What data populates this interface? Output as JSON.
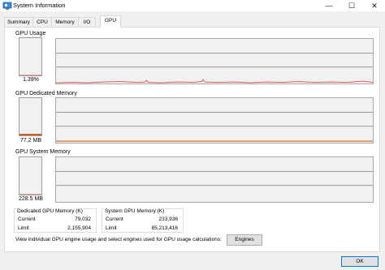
{
  "window": {
    "title": "System Information",
    "app_icon": "system-information-icon",
    "controls": {
      "minimize": "—",
      "maximize": "☐",
      "close": "✕"
    }
  },
  "tabs": [
    {
      "label": "Summary",
      "active": false
    },
    {
      "label": "CPU",
      "active": false
    },
    {
      "label": "Memory",
      "active": false
    },
    {
      "label": "I/O",
      "active": false
    },
    {
      "label": "GPU",
      "active": true
    }
  ],
  "sections": {
    "usage": {
      "label": "GPU Usage",
      "value": "1.39%",
      "level": 0.0139
    },
    "dedicated": {
      "label": "GPU Dedicated Memory",
      "value": "77.2 MB",
      "level": 0.04
    },
    "system": {
      "label": "GPU System Memory",
      "value": "228.5 MB",
      "level": 0.0
    }
  },
  "dedicated_group": {
    "title": "Dedicated GPU Memory (K)",
    "rows": [
      {
        "label": "Current",
        "value": "79,032"
      },
      {
        "label": "Limit",
        "value": "2,155,904"
      }
    ]
  },
  "system_group": {
    "title": "System GPU Memory (K)",
    "rows": [
      {
        "label": "Current",
        "value": "233,936"
      },
      {
        "label": "Limit",
        "value": "85,213,416"
      }
    ]
  },
  "hint": "View individual GPU engine usage and select engines used for GPU usage calculations:",
  "buttons": {
    "engines": "Engines",
    "ok": "OK"
  },
  "colors": {
    "graph_line": "#e0443a",
    "dedicated_line": "#d25c1e",
    "grid": "#7a7a7a",
    "window_bg": "#f0f0f0"
  }
}
